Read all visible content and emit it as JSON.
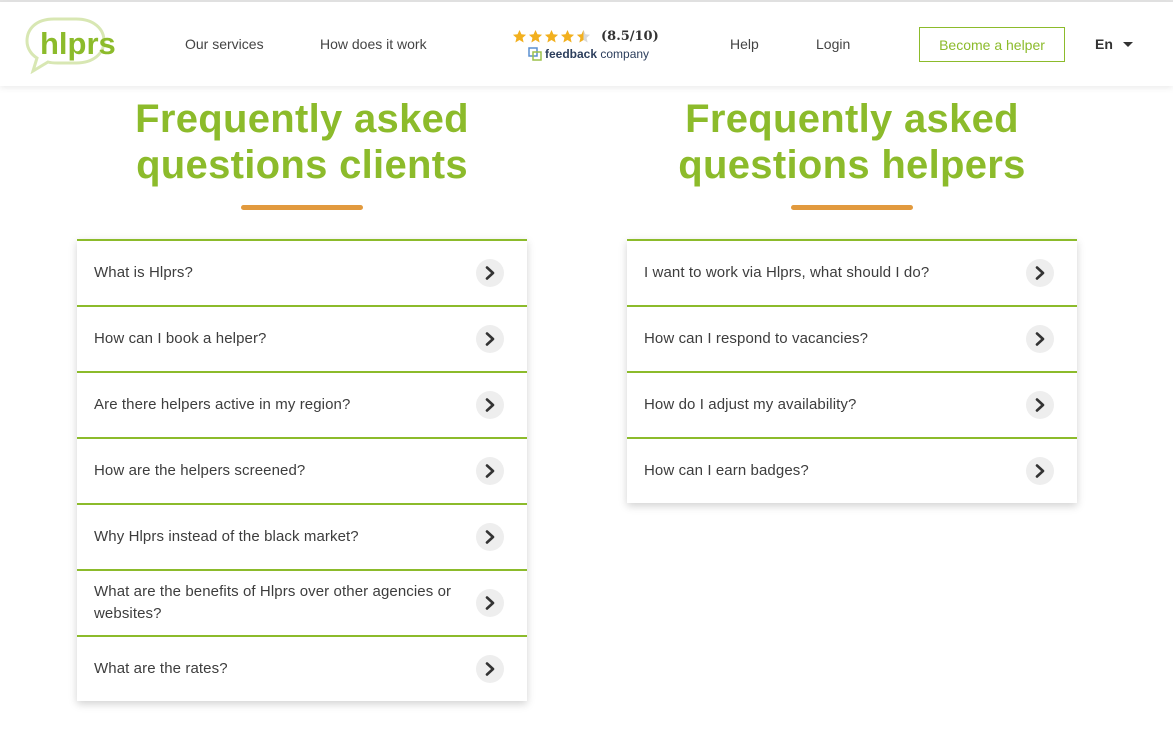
{
  "brand": {
    "logo_text": "hlprs",
    "green": "#8cbb2b",
    "orange": "#e29a3e"
  },
  "nav": {
    "services": "Our services",
    "how": "How does it work",
    "help": "Help",
    "login": "Login",
    "cta": "Become a helper",
    "language": "En"
  },
  "rating": {
    "stars": 4.5,
    "score": "(8.5/10)",
    "provider_bold": "feedback",
    "provider_rest": " company"
  },
  "clients": {
    "title_line1": "Frequently asked",
    "title_line2": "questions clients",
    "items": [
      "What is Hlprs?",
      "How can I book a helper?",
      "Are there helpers active in my region?",
      "How are the helpers screened?",
      "Why Hlprs instead of the black market?",
      "What are the benefits of Hlprs over other agencies or websites?",
      "What are the rates?"
    ]
  },
  "helpers": {
    "title_line1": "Frequently asked",
    "title_line2": "questions helpers",
    "items": [
      "I want to work via Hlprs, what should I do?",
      "How can I respond to vacancies?",
      "How do I adjust my availability?",
      "How can I earn badges?"
    ]
  }
}
